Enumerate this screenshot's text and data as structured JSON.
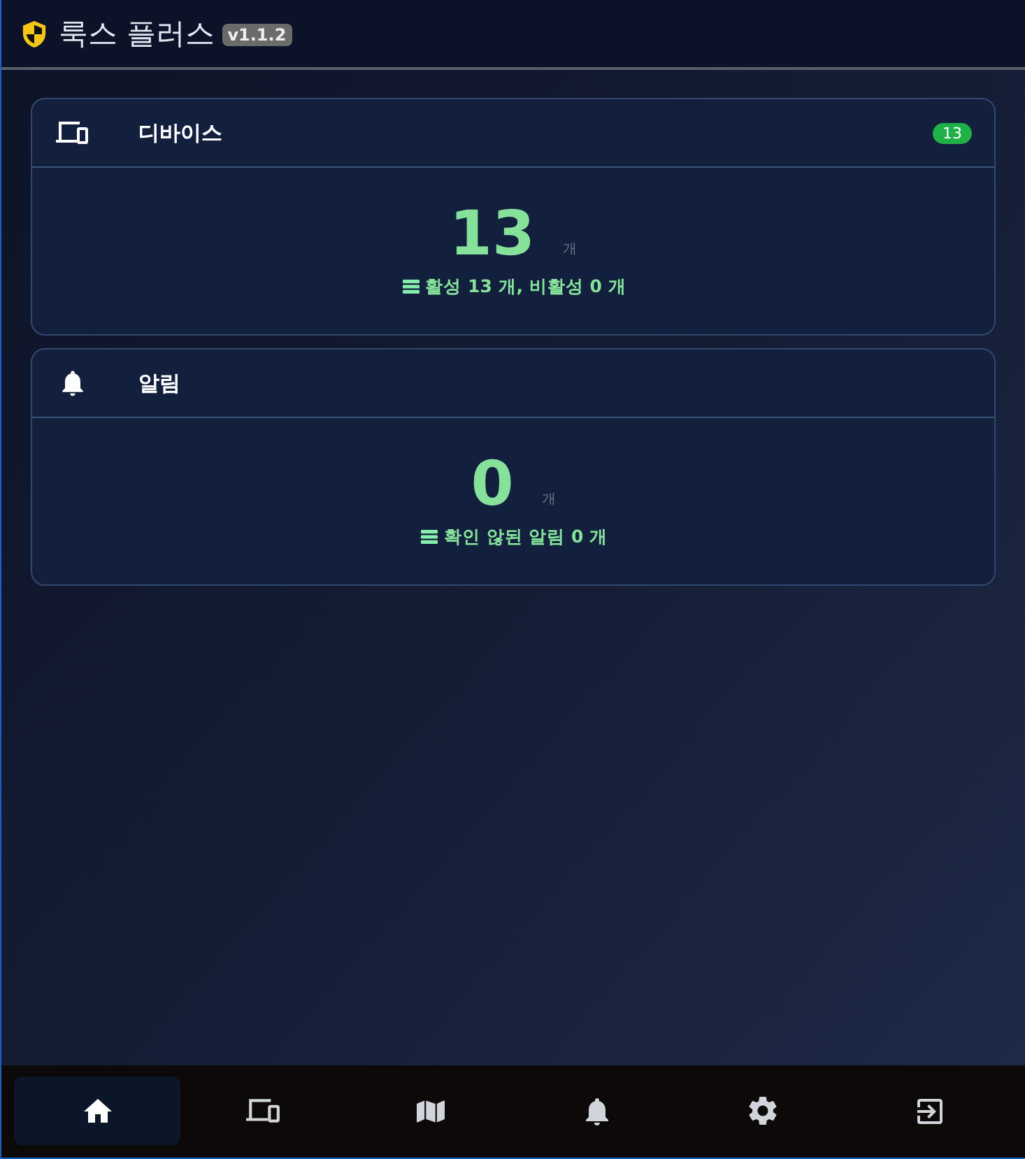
{
  "header": {
    "title": "룩스 플러스",
    "version": "v1.1.2"
  },
  "cards": [
    {
      "kind": "devices",
      "title": "디바이스",
      "badge": "13",
      "value": "13",
      "unit": "개",
      "summary": "활성 13 개, 비활성 0 개"
    },
    {
      "kind": "alerts",
      "title": "알림",
      "value": "0",
      "unit": "개",
      "summary": "확인 않된 알림 0 개"
    }
  ],
  "nav": [
    {
      "kind": "home",
      "selected": true
    },
    {
      "kind": "devices",
      "selected": false
    },
    {
      "kind": "map",
      "selected": false
    },
    {
      "kind": "alerts",
      "selected": false
    },
    {
      "kind": "settings",
      "selected": false
    },
    {
      "kind": "logout",
      "selected": false
    }
  ]
}
